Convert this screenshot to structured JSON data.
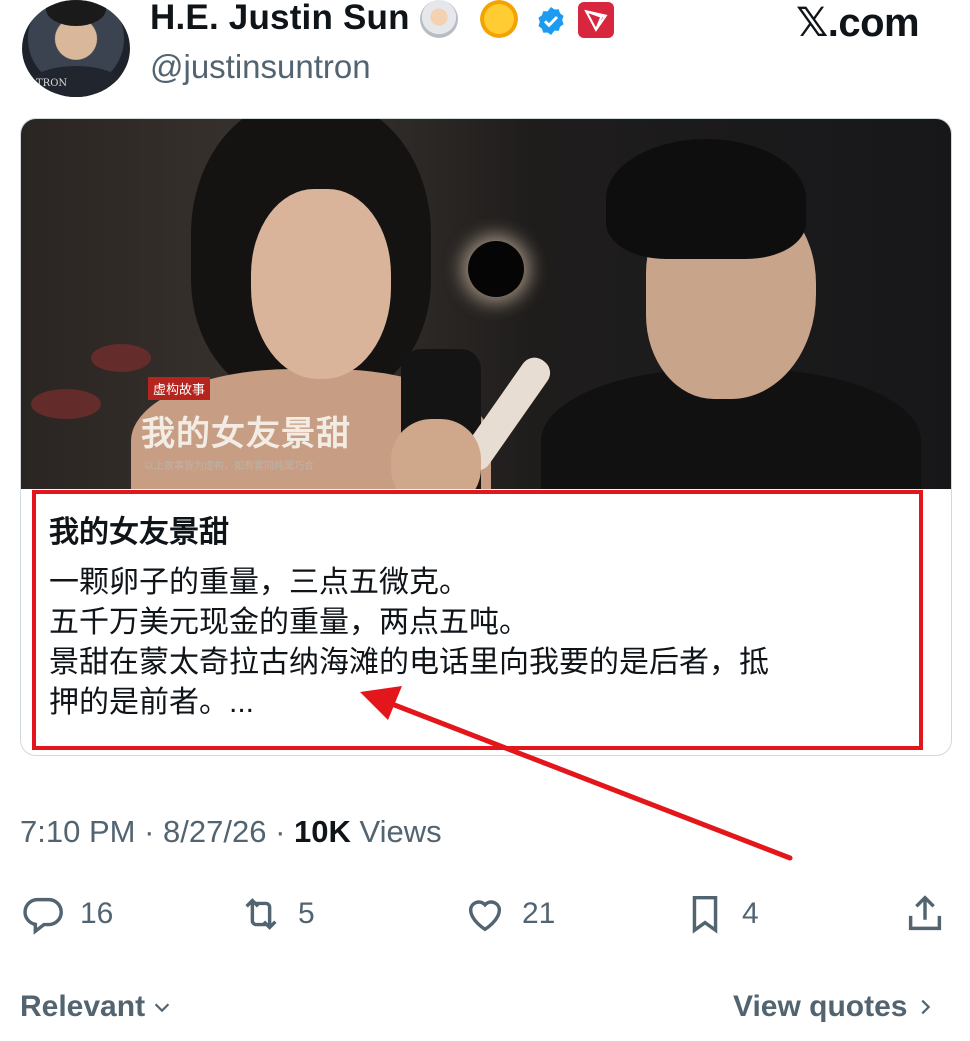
{
  "author": {
    "name": "H.E. Justin Sun",
    "handle": "@justinsuntron",
    "avatar_brand": "TRON",
    "badges": [
      "astronaut-emoji",
      "sun-emoji",
      "verified-badge",
      "tron-logo"
    ]
  },
  "site_logo": "𝕏.com",
  "card": {
    "poster": {
      "badge": "虚构故事",
      "title": "我的女友景甜",
      "subtitle": "以上故事皆为虚构，如有雷同纯属巧合"
    },
    "title": "我的女友景甜",
    "lines": [
      "一颗卵子的重量，三点五微克。",
      "五千万美元现金的重量，两点五吨。",
      "景甜在蒙太奇拉古纳海滩的电话里向我要的是后者，抵",
      "押的是前者。..."
    ]
  },
  "meta": {
    "time": "7:10 PM",
    "date": "8/27/26",
    "separator": "·",
    "views_count": "10K",
    "views_label": "Views"
  },
  "actions": {
    "replies": "16",
    "reposts": "5",
    "likes": "21",
    "bookmarks": "4"
  },
  "footer": {
    "sort_label": "Relevant",
    "view_quotes_label": "View quotes"
  },
  "colors": {
    "annotation_red": "#e3161b",
    "secondary_text": "#536471",
    "primary_text": "#0f1419",
    "verified_blue": "#1d9bf0",
    "tron_red": "#d7263d"
  }
}
